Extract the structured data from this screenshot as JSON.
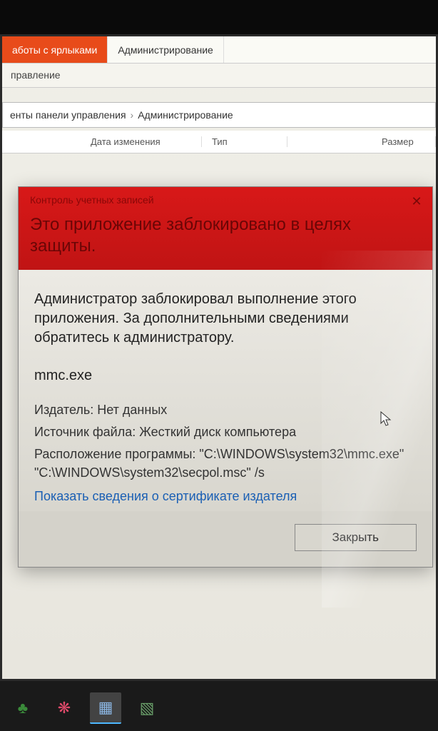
{
  "explorer": {
    "ribbon": {
      "tab_active": "аботы с ярлыками",
      "tab_other": "Администрирование",
      "sub_label": "правление"
    },
    "breadcrumb": {
      "part1": "енты панели управления",
      "part2": "Администрирование"
    },
    "columns": {
      "name": "",
      "date": "Дата изменения",
      "type": "Тип",
      "size": "Размер"
    }
  },
  "uac": {
    "title_small": "Контроль учетных записей",
    "title_big": "Это приложение заблокировано в целях защиты.",
    "message": "Администратор заблокировал выполнение этого приложения. За дополнительными сведениями обратитесь к администратору.",
    "exe": "mmc.exe",
    "publisher_label": "Издатель:",
    "publisher_value": "Нет данных",
    "source_label": "Источник файла:",
    "source_value": "Жесткий диск компьютера",
    "location_label": "Расположение программы:",
    "location_value": "\"C:\\WINDOWS\\system32\\mmc.exe\" \"C:\\WINDOWS\\system32\\secpol.msc\" /s",
    "cert_link": "Показать сведения о сертификате издателя",
    "close_btn": "Закрыть"
  }
}
